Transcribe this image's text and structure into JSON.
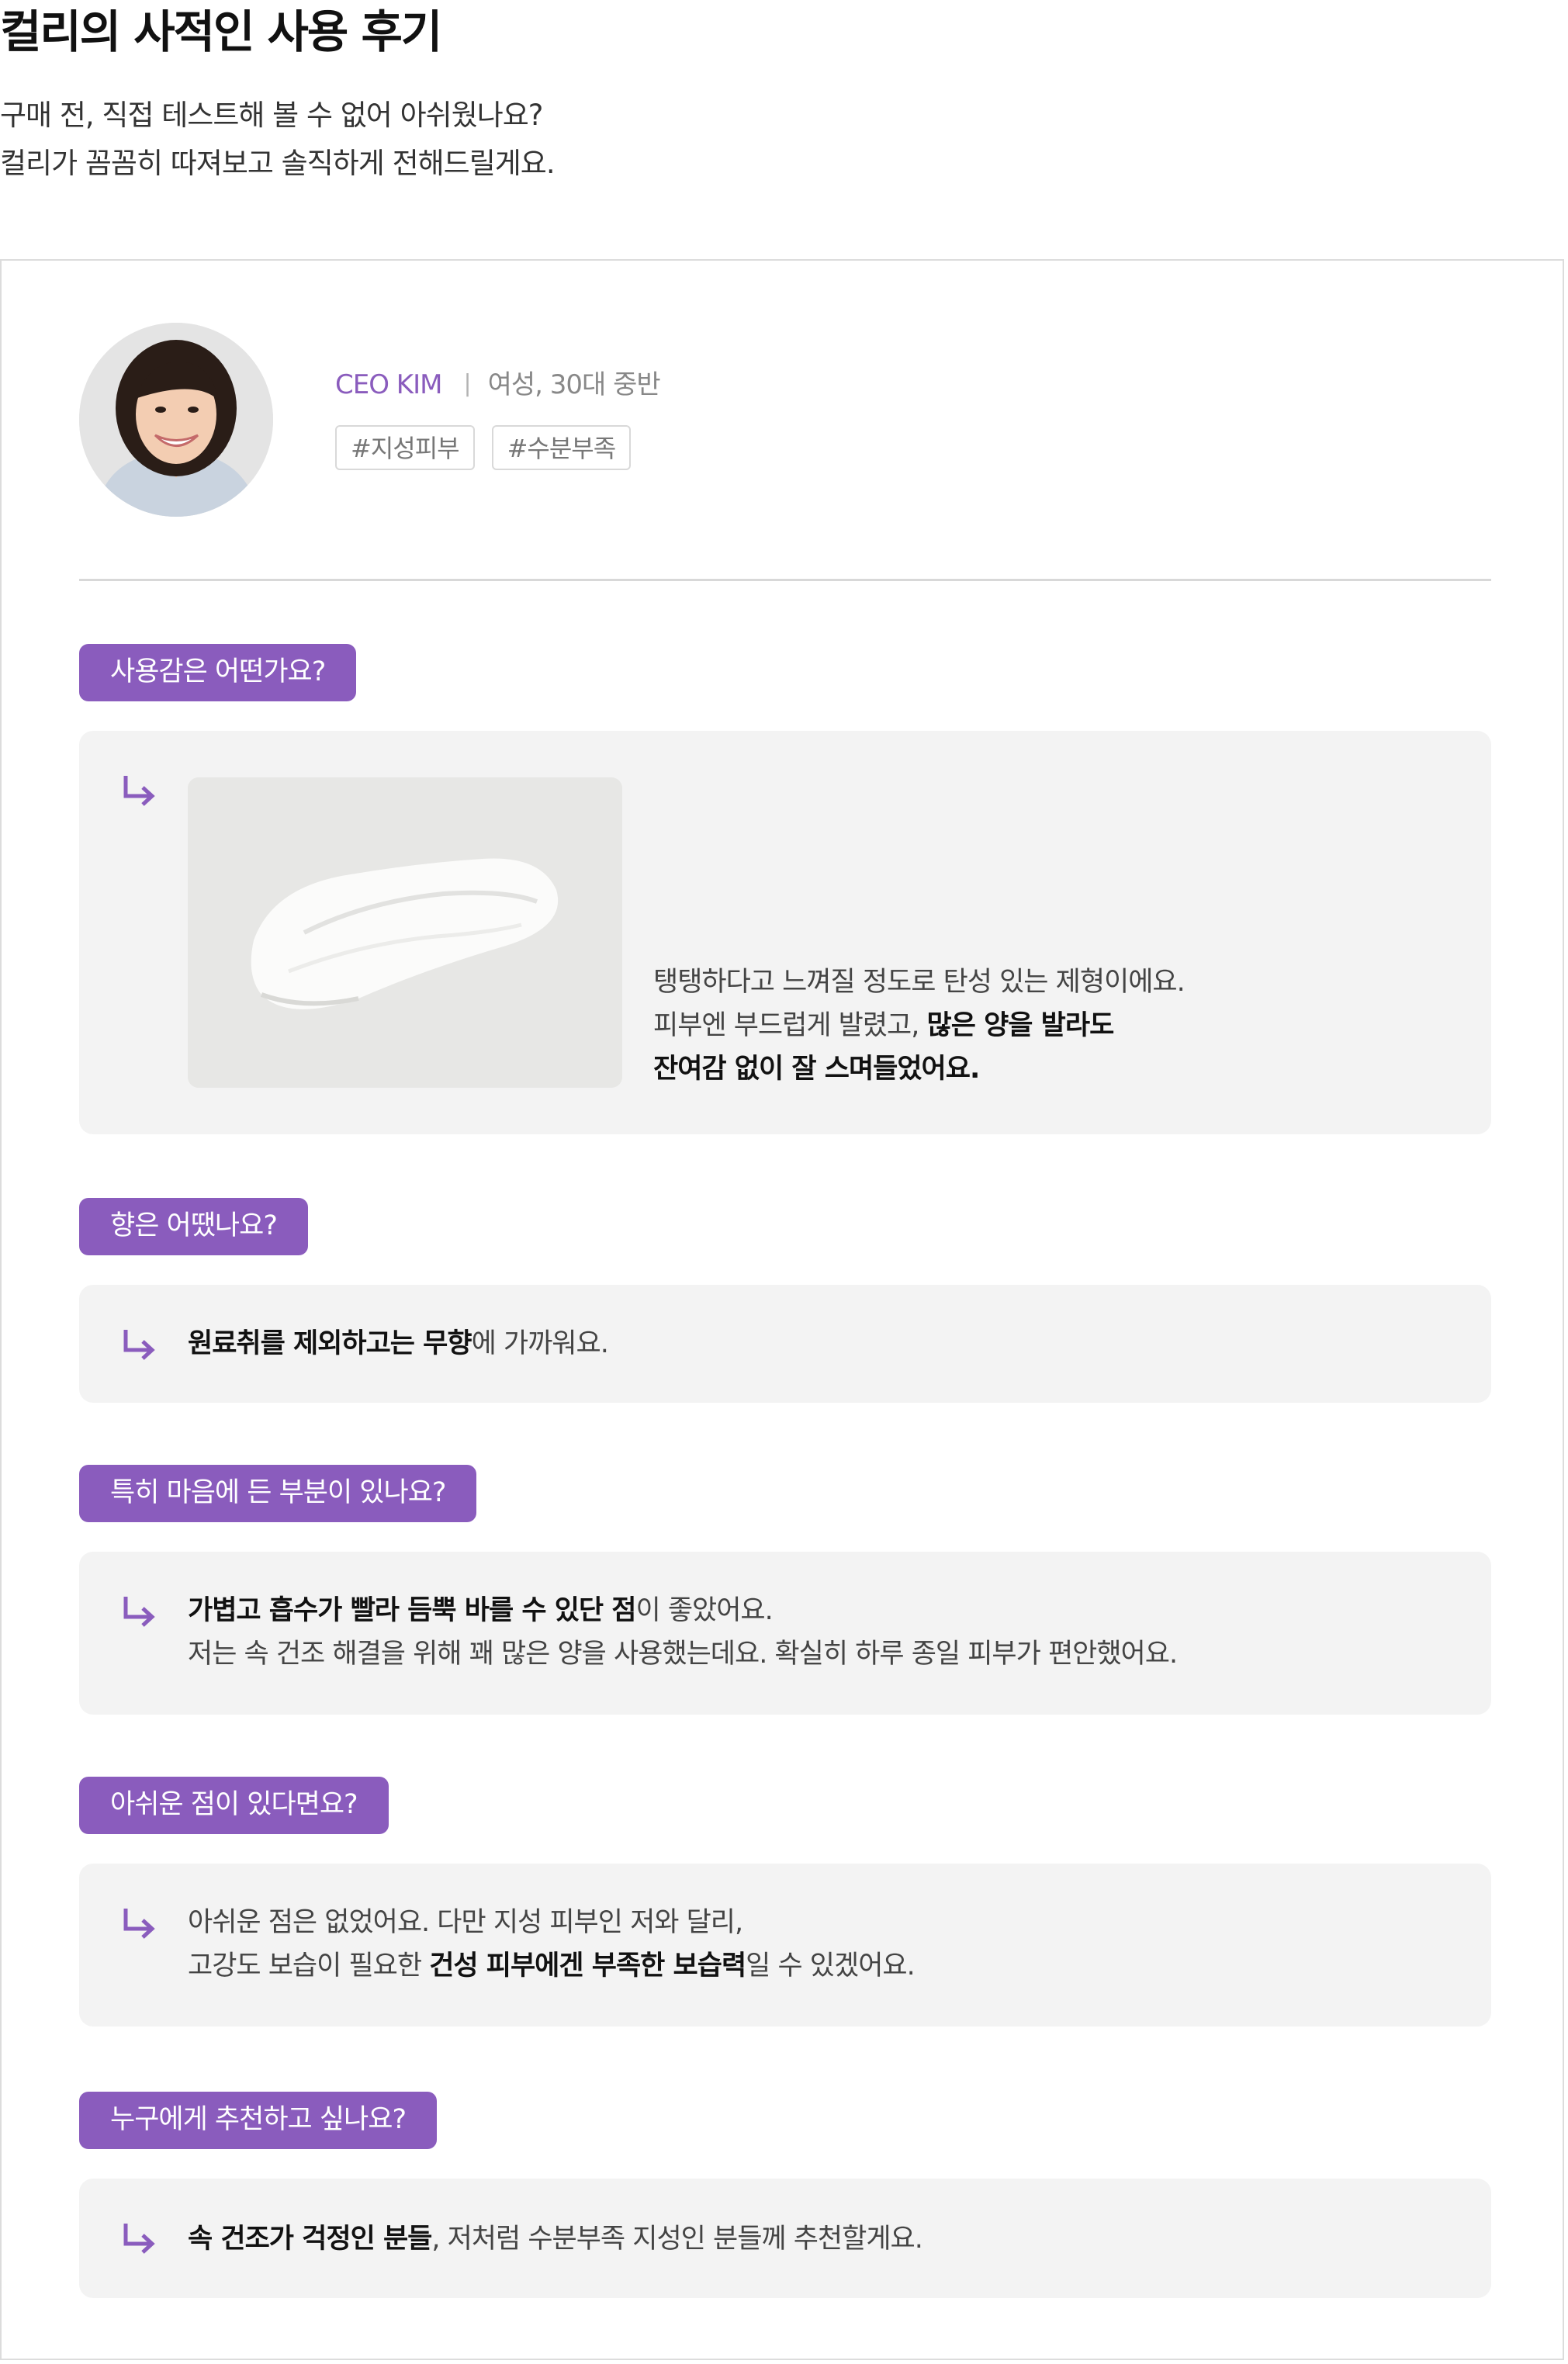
{
  "header": {
    "title": "컬리의 사적인 사용 후기",
    "intro_line1": "구매 전, 직접 테스트해 볼 수 없어 아쉬웠나요?",
    "intro_line2": "컬리가 꼼꼼히 따져보고 솔직하게 전해드릴게요."
  },
  "reviewer": {
    "name": "CEO KIM",
    "separator": "|",
    "meta": "여성, 30대 중반",
    "tags": [
      "#지성피부",
      "#수분부족"
    ]
  },
  "qa": [
    {
      "question": "사용감은 어떤가요?",
      "answer": [
        [
          {
            "t": "탱탱하다고 느껴질 정도로 탄성 있는 제형이에요.",
            "b": false
          }
        ],
        [
          {
            "t": "피부엔 부드럽게 발렸고, ",
            "b": false
          },
          {
            "t": "많은 양을 발라도",
            "b": true
          }
        ],
        [
          {
            "t": "잔여감 없이 잘 스며들었어요.",
            "b": true
          }
        ]
      ]
    },
    {
      "question": "향은 어땠나요?",
      "answer": [
        [
          {
            "t": "원료취를 제외하고는 무향",
            "b": true
          },
          {
            "t": "에 가까워요.",
            "b": false
          }
        ]
      ]
    },
    {
      "question": "특히 마음에 든 부분이 있나요?",
      "answer": [
        [
          {
            "t": "가볍고 흡수가 빨라 듬뿍 바를 수 있단 점",
            "b": true
          },
          {
            "t": "이 좋았어요.",
            "b": false
          }
        ],
        [
          {
            "t": "저는 속 건조 해결을 위해 꽤 많은 양을 사용했는데요. 확실히 하루 종일 피부가 편안했어요.",
            "b": false
          }
        ]
      ]
    },
    {
      "question": "아쉬운 점이 있다면요?",
      "answer": [
        [
          {
            "t": "아쉬운 점은 없었어요. 다만 지성 피부인 저와 달리,",
            "b": false
          }
        ],
        [
          {
            "t": "고강도 보습이 필요한 ",
            "b": false
          },
          {
            "t": "건성 피부에겐 부족한 보습력",
            "b": true
          },
          {
            "t": "일 수 있겠어요.",
            "b": false
          }
        ]
      ]
    },
    {
      "question": "누구에게 추천하고 싶나요?",
      "answer": [
        [
          {
            "t": "속 건조가 걱정인 분들",
            "b": true
          },
          {
            "t": ", 저처럼 수분부족 지성인 분들께 추천할게요.",
            "b": false
          }
        ]
      ]
    }
  ],
  "colors": {
    "accent": "#8a5cbd",
    "answer_bg": "#f3f3f3",
    "border": "#dcdcdc"
  },
  "icons": {
    "answer_marker": "arrow-return-right-icon"
  }
}
